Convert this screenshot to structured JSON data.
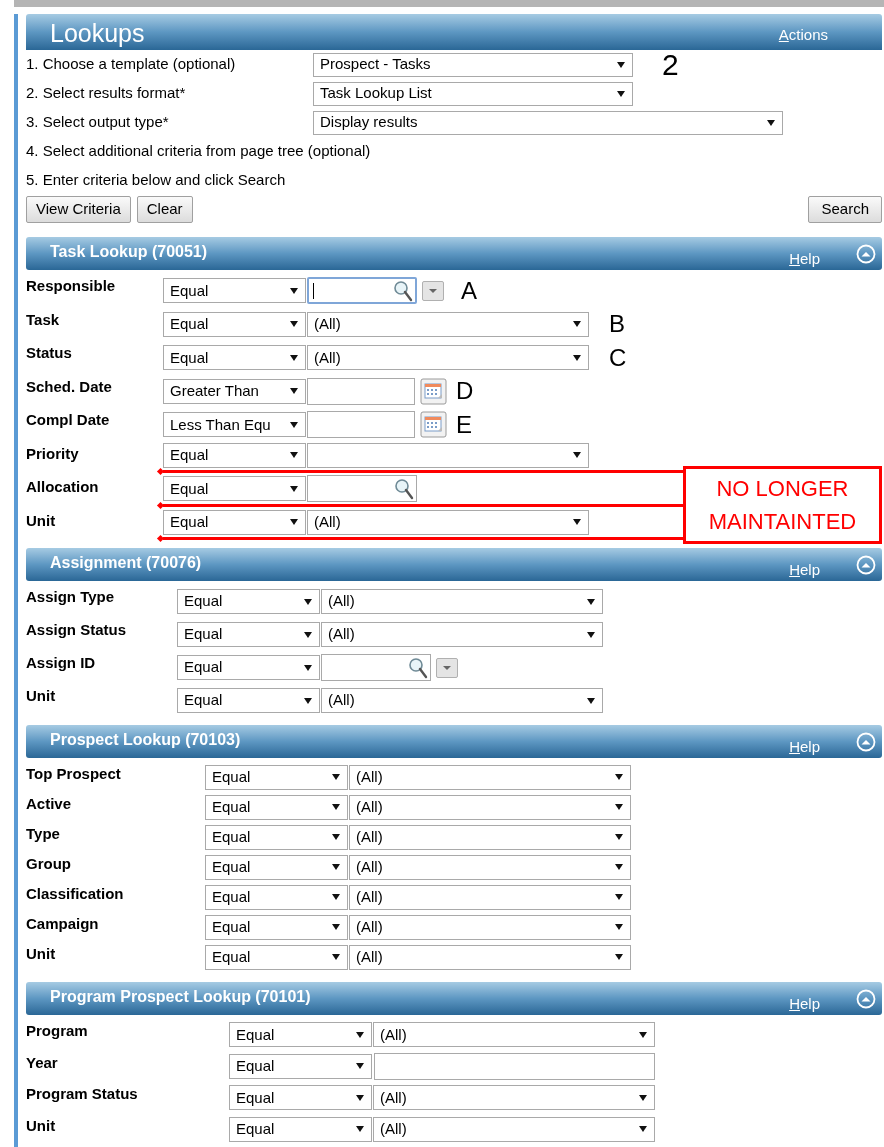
{
  "header": {
    "title": "Lookups",
    "actions_link": "Actions"
  },
  "steps": [
    {
      "text": "1. Choose a template (optional)",
      "kind": "short",
      "select": "Prospect - Tasks",
      "annotation": "2"
    },
    {
      "text": "2. Select results format*",
      "kind": "short",
      "select": "Task Lookup List"
    },
    {
      "text": "3. Select output type*",
      "kind": "long",
      "select": "Display results"
    },
    {
      "text": "4. Select additional criteria from page tree (optional)",
      "kind": "none"
    },
    {
      "text": "5. Enter criteria below and click Search",
      "kind": "none"
    }
  ],
  "buttons": [
    "View Criteria",
    "Clear"
  ],
  "search_button": "Search",
  "sections": [
    {
      "title": "Task Lookup (70051)",
      "help": "Help",
      "note": "NO LONGER MAINTAINTED",
      "rows": [
        {
          "label": "Responsible",
          "kind": "lookup",
          "operator": "Equal",
          "focused": true,
          "menu_button": true,
          "struck": false,
          "annotation": "A"
        },
        {
          "label": "Task",
          "kind": "select",
          "operator": "Equal",
          "value": "(All)",
          "struck": false,
          "annotation": "B"
        },
        {
          "label": "Status",
          "kind": "select",
          "operator": "Equal",
          "value": "(All)",
          "struck": false,
          "annotation": "C"
        },
        {
          "label": "Sched. Date",
          "kind": "date",
          "operator": "Greater Than",
          "struck": false,
          "annotation": "D"
        },
        {
          "label": "Compl Date",
          "kind": "date",
          "operator": "Less Than Equ",
          "struck": false,
          "annotation": "E"
        },
        {
          "label": "Priority",
          "kind": "select",
          "operator": "Equal",
          "struck": true
        },
        {
          "label": "Allocation",
          "kind": "lookup",
          "operator": "Equal",
          "focused": false,
          "menu_button": false,
          "struck": true
        },
        {
          "label": "Unit",
          "kind": "select",
          "operator": "Equal",
          "value": "(All)",
          "struck": true
        }
      ]
    },
    {
      "title": "Assignment (70076)",
      "help": "Help",
      "rows": [
        {
          "label": "Assign Type",
          "kind": "select",
          "operator": "Equal",
          "value": "(All)",
          "struck": false
        },
        {
          "label": "Assign Status",
          "kind": "select",
          "operator": "Equal",
          "value": "(All)",
          "struck": false
        },
        {
          "label": "Assign ID",
          "kind": "lookup",
          "operator": "Equal",
          "focused": false,
          "menu_button": true,
          "struck": false
        },
        {
          "label": "Unit",
          "kind": "select",
          "operator": "Equal",
          "value": "(All)",
          "struck": false
        }
      ]
    },
    {
      "title": "Prospect Lookup (70103)",
      "help": "Help",
      "rows": [
        {
          "label": "Top Prospect",
          "kind": "select",
          "operator": "Equal",
          "value": "(All)",
          "struck": false
        },
        {
          "label": "Active",
          "kind": "select",
          "operator": "Equal",
          "value": "(All)",
          "struck": false
        },
        {
          "label": "Type",
          "kind": "select",
          "operator": "Equal",
          "value": "(All)",
          "struck": false
        },
        {
          "label": "Group",
          "kind": "select",
          "operator": "Equal",
          "value": "(All)",
          "struck": false
        },
        {
          "label": "Classification",
          "kind": "select",
          "operator": "Equal",
          "value": "(All)",
          "struck": false
        },
        {
          "label": "Campaign",
          "kind": "select",
          "operator": "Equal",
          "value": "(All)",
          "struck": false
        },
        {
          "label": "Unit",
          "kind": "select",
          "operator": "Equal",
          "value": "(All)",
          "struck": false
        }
      ]
    },
    {
      "title": "Program Prospect Lookup (70101)",
      "help": "Help",
      "rows": [
        {
          "label": "Program",
          "kind": "select",
          "operator": "Equal",
          "value": "(All)",
          "struck": false
        },
        {
          "label": "Year",
          "kind": "text",
          "operator": "Equal",
          "struck": false
        },
        {
          "label": "Program Status",
          "kind": "select",
          "operator": "Equal",
          "value": "(All)",
          "struck": false
        },
        {
          "label": "Unit",
          "kind": "select",
          "operator": "Equal",
          "value": "(All)",
          "struck": false
        }
      ]
    }
  ]
}
